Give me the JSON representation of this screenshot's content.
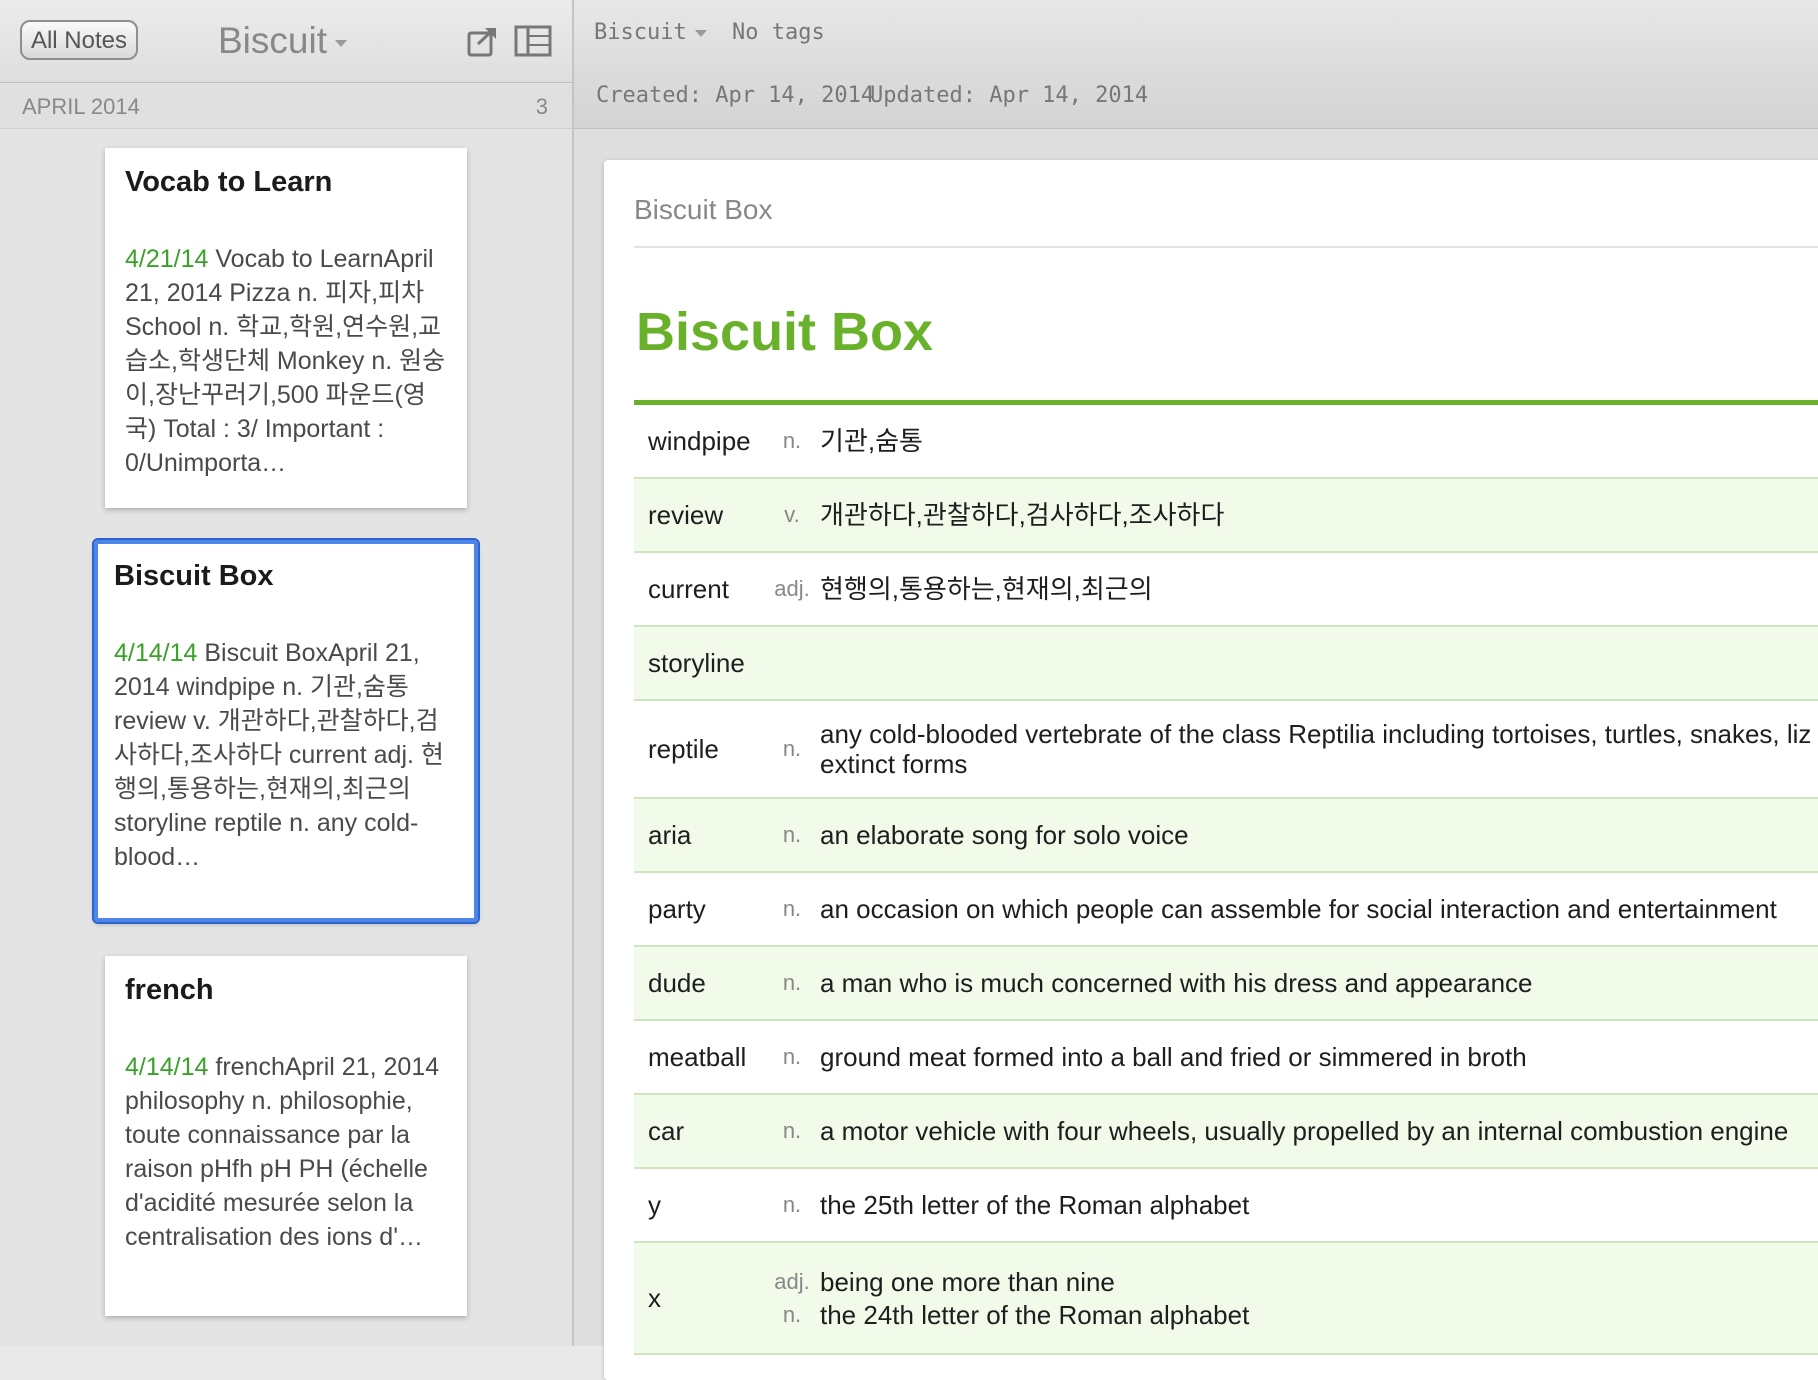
{
  "sidebar": {
    "all_notes_label": "All Notes",
    "notebook_title": "Biscuit",
    "share_icon": "share-icon",
    "layout_icon": "layout-toggle-icon",
    "date_group": "APRIL 2014",
    "note_count": "3",
    "notes": [
      {
        "title": "Vocab to Learn",
        "date": "4/21/14",
        "snippet": " Vocab to LearnApril 21, 2014 Pizza n. 피자,피차 School n. 학교,학원,연수원,교습소,학생단체 Monkey n. 원숭이,장난꾸러기,500 파운드(영국) Total : 3/ Important : 0/Unimporta…"
      },
      {
        "title": "Biscuit Box",
        "date": "4/14/14",
        "snippet": " Biscuit BoxApril 21, 2014 windpipe n. 기관,숨통 review v. 개관하다,관찰하다,검사하다,조사하다 current adj. 현행의,통용하는,현재의,최근의 storyline reptile n. any cold-blood…"
      },
      {
        "title": "french",
        "date": "4/14/14",
        "snippet": " frenchApril 21, 2014 philosophy n. philosophie, toute connaissance par la raison pHfh pH PH (échelle d'acidité mesurée selon la centralisation des ions d'…"
      }
    ]
  },
  "header": {
    "notebook": "Biscuit",
    "tags": "No tags",
    "created": "Created: Apr 14, 2014",
    "updated": "Updated: Apr 14, 2014"
  },
  "note": {
    "title_field": "Biscuit Box",
    "heading": "Biscuit Box",
    "accent_color": "#6ab12b",
    "vocab": [
      {
        "word": "windpipe",
        "defs": [
          {
            "pos": "n.",
            "text": "기관,숨통"
          }
        ]
      },
      {
        "word": "review",
        "defs": [
          {
            "pos": "v.",
            "text": "개관하다,관찰하다,검사하다,조사하다"
          }
        ]
      },
      {
        "word": "current",
        "defs": [
          {
            "pos": "adj.",
            "text": "현행의,통용하는,현재의,최근의"
          }
        ]
      },
      {
        "word": "storyline",
        "defs": []
      },
      {
        "word": "reptile",
        "defs": [
          {
            "pos": "n.",
            "text": "any cold-blooded vertebrate of the class Reptilia including tortoises, turtles, snakes, liz extinct forms"
          }
        ]
      },
      {
        "word": "aria",
        "defs": [
          {
            "pos": "n.",
            "text": "an elaborate song for solo voice"
          }
        ]
      },
      {
        "word": "party",
        "defs": [
          {
            "pos": "n.",
            "text": "an occasion on which people can assemble for social interaction and entertainment"
          }
        ]
      },
      {
        "word": "dude",
        "defs": [
          {
            "pos": "n.",
            "text": "a man who is much concerned with his dress and appearance"
          }
        ]
      },
      {
        "word": "meatball",
        "defs": [
          {
            "pos": "n.",
            "text": "ground meat formed into a ball and fried or simmered in broth"
          }
        ]
      },
      {
        "word": "car",
        "defs": [
          {
            "pos": "n.",
            "text": "a motor vehicle with four wheels, usually propelled by an internal combustion engine"
          }
        ]
      },
      {
        "word": "y",
        "defs": [
          {
            "pos": "n.",
            "text": "the 25th letter of the Roman alphabet"
          }
        ]
      },
      {
        "word": "x",
        "defs": [
          {
            "pos": "adj.",
            "text": "being one more than nine"
          },
          {
            "pos": "n.",
            "text": "the 24th letter of the Roman alphabet"
          }
        ]
      }
    ]
  }
}
